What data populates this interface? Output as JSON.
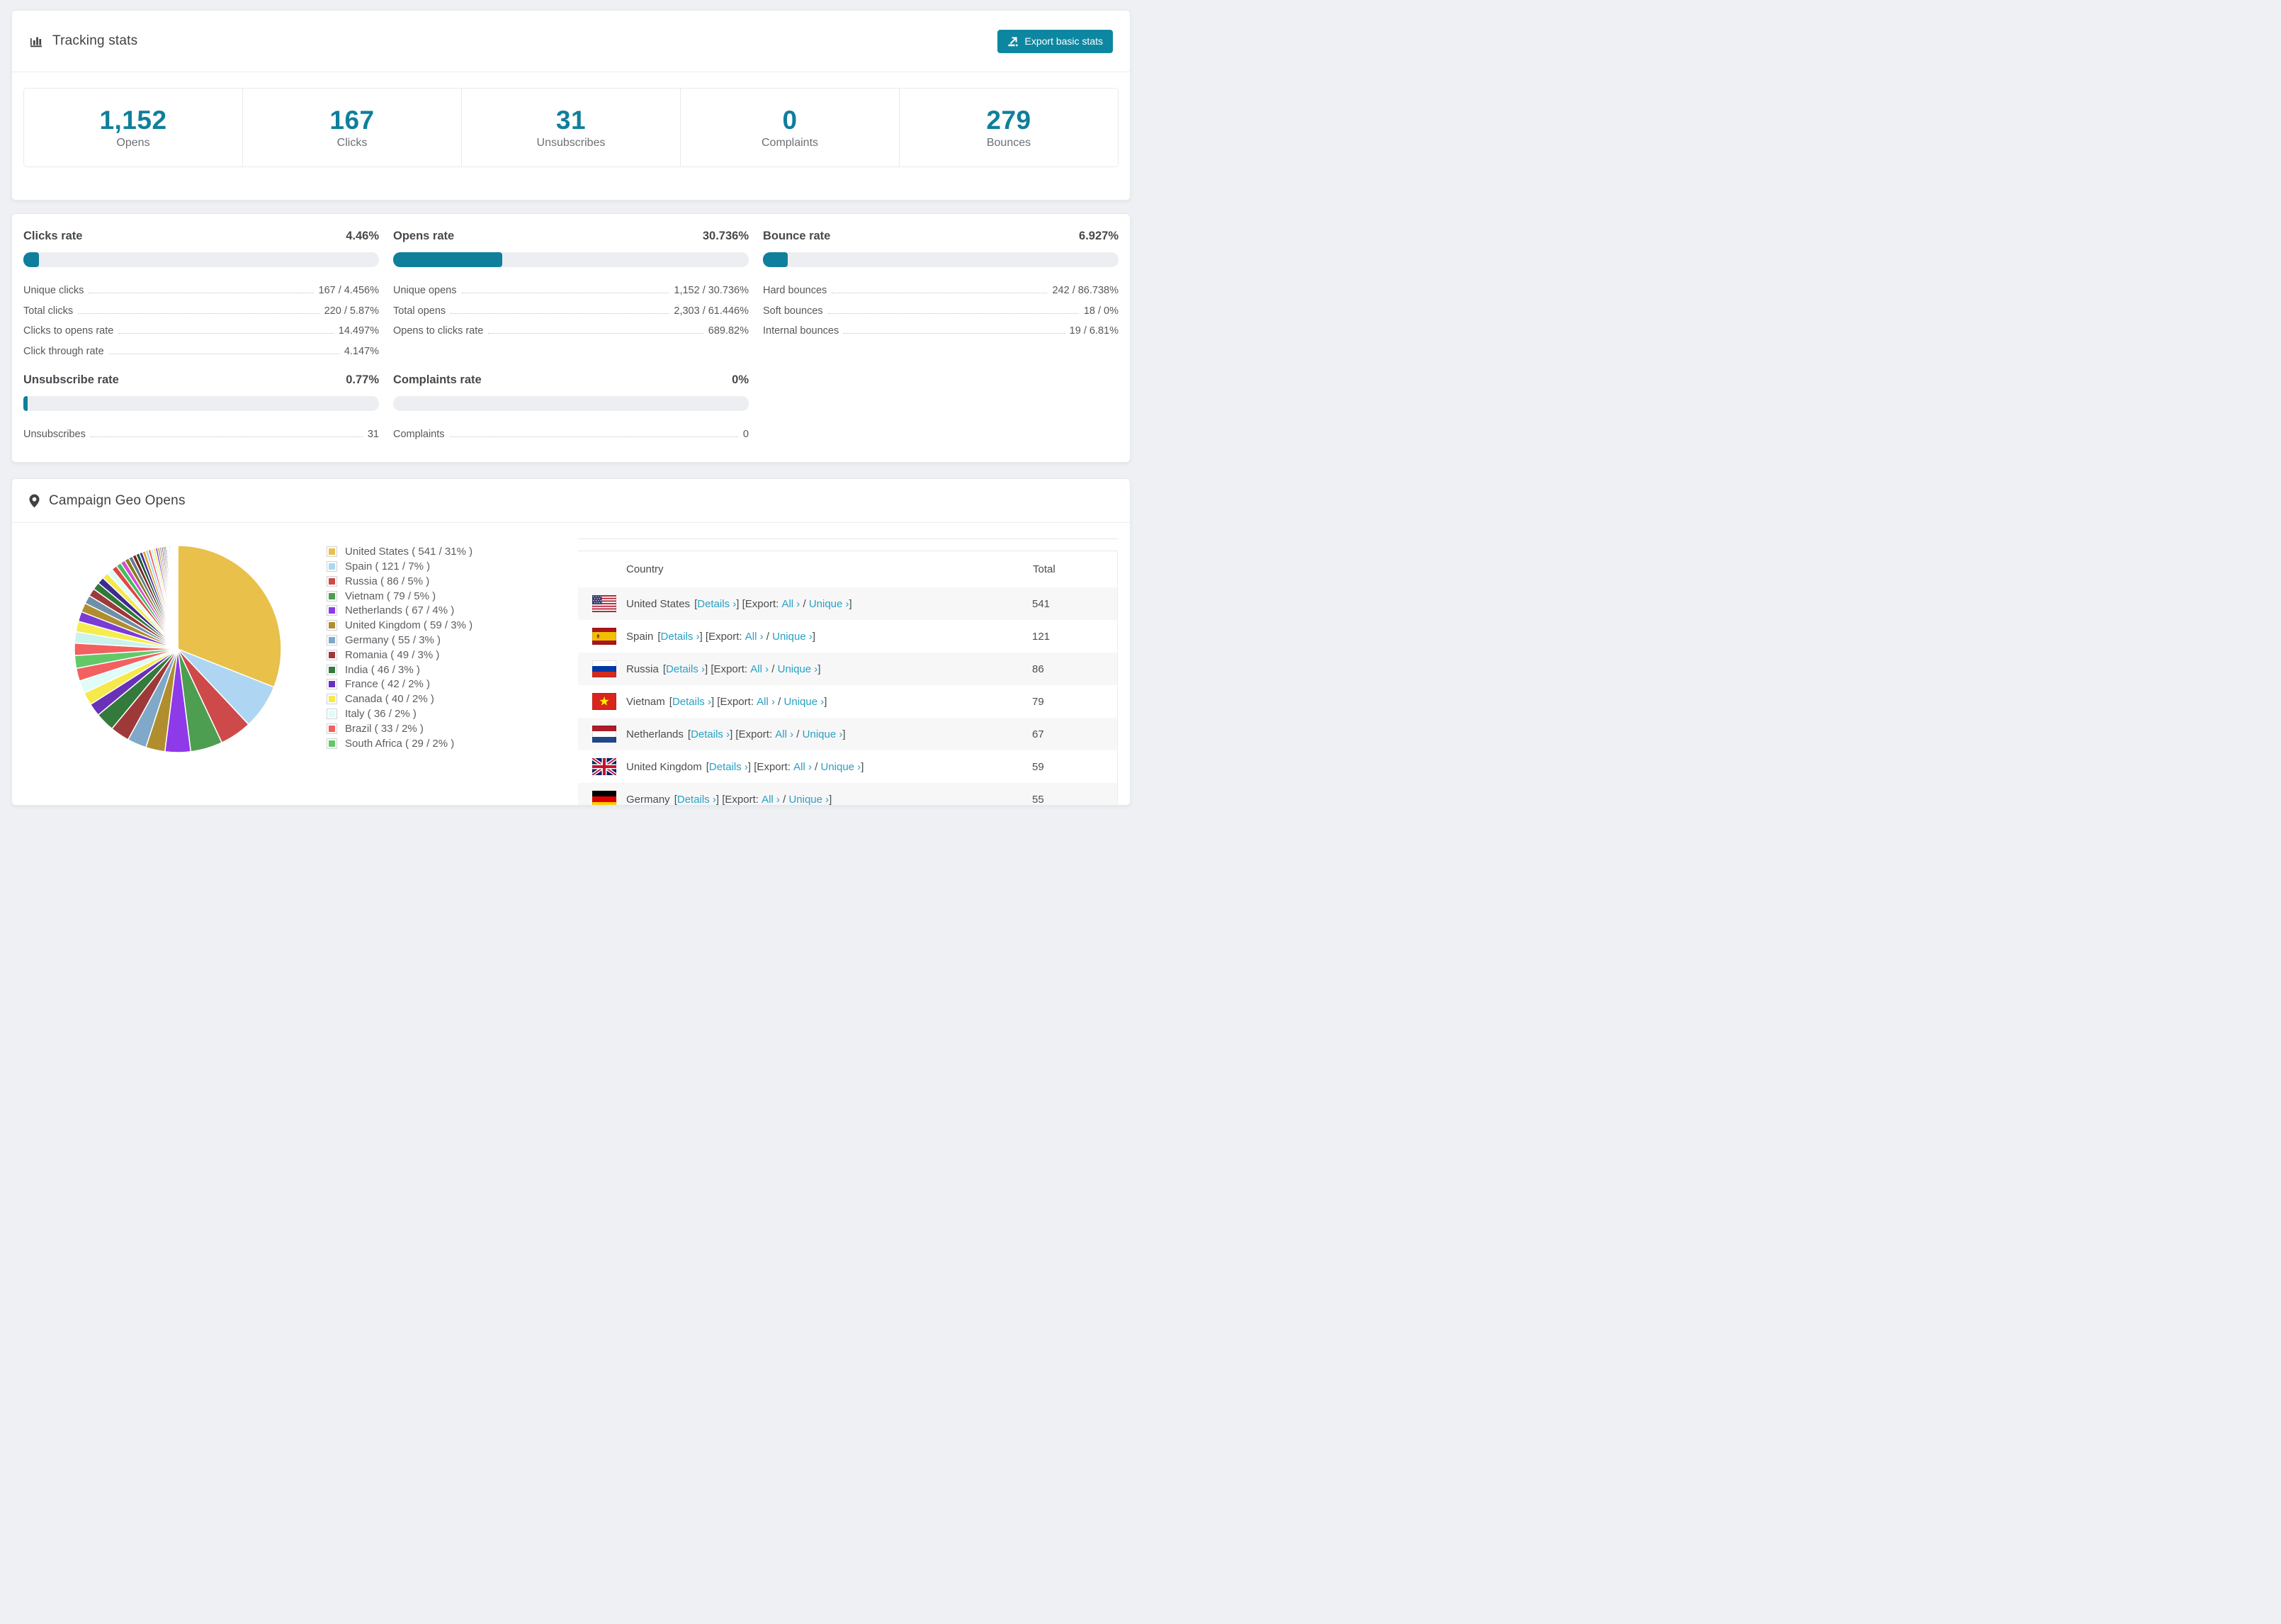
{
  "colors": {
    "accent_teal": "#0f7f9c",
    "button_teal": "#0d87a1",
    "link_teal": "#2aa0c2",
    "page_bg": "#eef0f3",
    "progress_track": "#eceef1"
  },
  "tracking": {
    "title": "Tracking stats",
    "export_label": "Export basic stats",
    "stats": [
      {
        "value": "1,152",
        "label": "Opens"
      },
      {
        "value": "167",
        "label": "Clicks"
      },
      {
        "value": "31",
        "label": "Unsubscribes"
      },
      {
        "value": "0",
        "label": "Complaints"
      },
      {
        "value": "279",
        "label": "Bounces"
      }
    ]
  },
  "rates": [
    {
      "slug": "clicks-rate",
      "title": "Clicks rate",
      "value": "4.46%",
      "pct": 4.46,
      "rows": [
        {
          "label": "Unique clicks",
          "value": "167 / 4.456%"
        },
        {
          "label": "Total clicks",
          "value": "220 / 5.87%"
        },
        {
          "label": "Clicks to opens rate",
          "value": "14.497%"
        },
        {
          "label": "Click through rate",
          "value": "4.147%"
        }
      ]
    },
    {
      "slug": "opens-rate",
      "title": "Opens rate",
      "value": "30.736%",
      "pct": 30.736,
      "rows": [
        {
          "label": "Unique opens",
          "value": "1,152 / 30.736%"
        },
        {
          "label": "Total opens",
          "value": "2,303 / 61.446%"
        },
        {
          "label": "Opens to clicks rate",
          "value": "689.82%"
        }
      ]
    },
    {
      "slug": "bounce-rate",
      "title": "Bounce rate",
      "value": "6.927%",
      "pct": 6.927,
      "rows": [
        {
          "label": "Hard bounces",
          "value": "242 / 86.738%"
        },
        {
          "label": "Soft bounces",
          "value": "18 / 0%"
        },
        {
          "label": "Internal bounces",
          "value": "19 / 6.81%"
        }
      ]
    },
    {
      "slug": "unsubscribe-rate",
      "title": "Unsubscribe rate",
      "value": "0.77%",
      "pct": 0.77,
      "rows": [
        {
          "label": "Unsubscribes",
          "value": "31"
        }
      ]
    },
    {
      "slug": "complaints-rate",
      "title": "Complaints rate",
      "value": "0%",
      "pct": 0,
      "rows": [
        {
          "label": "Complaints",
          "value": "0"
        }
      ]
    }
  ],
  "geo": {
    "title": "Campaign Geo Opens",
    "legend_format": "{label} ( {value} / {pct}% )",
    "chart_data": {
      "type": "pie",
      "title": "Campaign Geo Opens",
      "start_angle_deg": -90,
      "direction": "clockwise",
      "slices": [
        {
          "label": "United States",
          "value": 541,
          "pct": 31,
          "color": "#e8c04a"
        },
        {
          "label": "Spain",
          "value": 121,
          "pct": 7,
          "color": "#aed6f2"
        },
        {
          "label": "Russia",
          "value": 86,
          "pct": 5,
          "color": "#ce4a4a"
        },
        {
          "label": "Vietnam",
          "value": 79,
          "pct": 5,
          "color": "#4d9e50"
        },
        {
          "label": "Netherlands",
          "value": 67,
          "pct": 4,
          "color": "#8e3ae8"
        },
        {
          "label": "United Kingdom",
          "value": 59,
          "pct": 3,
          "color": "#b08e2d"
        },
        {
          "label": "Germany",
          "value": 55,
          "pct": 3,
          "color": "#7fa8c9"
        },
        {
          "label": "Romania",
          "value": 49,
          "pct": 3,
          "color": "#9e3939"
        },
        {
          "label": "India",
          "value": 46,
          "pct": 3,
          "color": "#337a3c"
        },
        {
          "label": "France",
          "value": 42,
          "pct": 2,
          "color": "#6930b8"
        },
        {
          "label": "Canada",
          "value": 40,
          "pct": 2,
          "color": "#f7e84b"
        },
        {
          "label": "Italy",
          "value": 36,
          "pct": 2,
          "color": "#dffcf7"
        },
        {
          "label": "Brazil",
          "value": 33,
          "pct": 2,
          "color": "#f26060"
        },
        {
          "label": "South Africa",
          "value": 29,
          "pct": 2,
          "color": "#62c968"
        }
      ],
      "unlabeled_tail": {
        "approx_total_pct": 26,
        "slice_count": 42,
        "decay": 0.93,
        "palette": [
          "#f26060",
          "#c9f3ec",
          "#f5ec4e",
          "#7a3bd6",
          "#b08e2d",
          "#6f8fa8",
          "#9e3939",
          "#2f7a38",
          "#3d2b8e",
          "#f7e84b",
          "#dffcf7",
          "#e04848",
          "#44bd5e",
          "#d44fd4",
          "#8a7a1f",
          "#607d8b",
          "#7a2525",
          "#1e5b2a",
          "#4a2d9e",
          "#d4a62a",
          "#a8d4f0"
        ]
      }
    },
    "table": {
      "headers": {
        "country": "Country",
        "total": "Total"
      },
      "fmt": {
        "b_open": "[",
        "b_close": "]",
        "details": "Details ›",
        "export_prefix": "[Export:",
        "all": "All ›",
        "slash": "/",
        "unique": "Unique ›"
      },
      "rows": [
        {
          "country": "United States",
          "flag": "us",
          "total": "541"
        },
        {
          "country": "Spain",
          "flag": "es",
          "total": "121"
        },
        {
          "country": "Russia",
          "flag": "ru",
          "total": "86"
        },
        {
          "country": "Vietnam",
          "flag": "vn",
          "total": "79"
        },
        {
          "country": "Netherlands",
          "flag": "nl",
          "total": "67"
        },
        {
          "country": "United Kingdom",
          "flag": "gb",
          "total": "59"
        },
        {
          "country": "Germany",
          "flag": "de",
          "total": "55",
          "partial": true
        }
      ]
    }
  }
}
